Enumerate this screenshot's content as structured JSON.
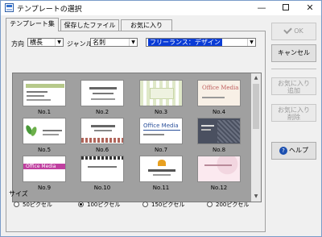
{
  "window": {
    "title": "テンプレートの選択"
  },
  "titlebar": {
    "minimize": "—",
    "close": "✕"
  },
  "tabs": [
    {
      "label": "テンプレート集",
      "active": true
    },
    {
      "label": "保存したファイルから",
      "active": false
    },
    {
      "label": "お気に入り",
      "active": false
    }
  ],
  "filters": {
    "orientation_label": "方向",
    "orientation_value": "横長",
    "genre_label": "ジャンル",
    "genre_value": "名刺",
    "category_value": "フリーランス：デザイン"
  },
  "templates": [
    {
      "label": "No.1"
    },
    {
      "label": "No.2"
    },
    {
      "label": "No.3"
    },
    {
      "label": "No.4"
    },
    {
      "label": "No.5"
    },
    {
      "label": "No.6"
    },
    {
      "label": "No.7",
      "text": "Office Media"
    },
    {
      "label": "No.8"
    },
    {
      "label": "No.9",
      "text": "Office Media"
    },
    {
      "label": "No.10"
    },
    {
      "label": "No.11"
    },
    {
      "label": "No.12"
    }
  ],
  "card_texts": {
    "no4": "Office Media"
  },
  "size": {
    "title": "サイズ",
    "options": [
      {
        "label": "50ピクセル",
        "checked": false
      },
      {
        "label": "100ピクセル",
        "checked": true
      },
      {
        "label": "150ピクセル",
        "checked": false
      },
      {
        "label": "200ピクセル",
        "checked": false
      }
    ]
  },
  "buttons": {
    "ok": "OK",
    "cancel": "キャンセル",
    "add_fav_line1": "お気に入り",
    "add_fav_line2": "追加",
    "del_fav_line1": "お気に入り",
    "del_fav_line2": "削除",
    "help": "ヘルプ"
  }
}
